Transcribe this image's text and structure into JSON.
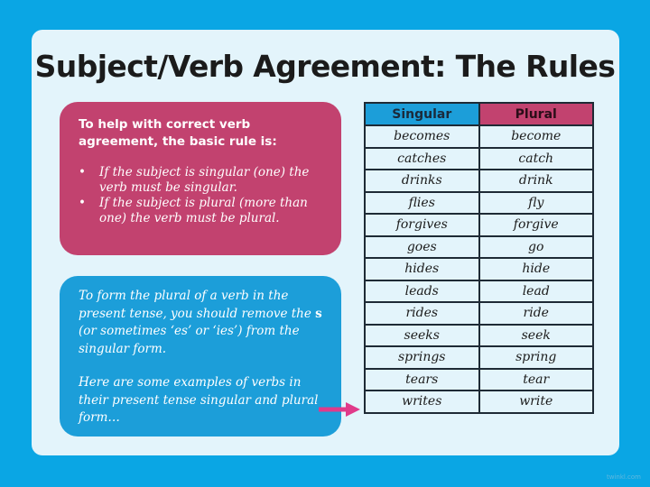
{
  "title": "Subject/Verb Agreement: The Rules",
  "rule_box": {
    "intro": "To help with correct verb agreement, the basic rule is:",
    "bullets": [
      "If the subject is singular (one) the verb must be singular.",
      "If the subject is plural (more than one) the verb must be plural."
    ],
    "bullet_glyph": "•"
  },
  "plural_box": {
    "para1_before": "To form the plural of a verb in the present tense, you should remove the ",
    "para1_bold": "s",
    "para1_after": " (or sometimes ‘es’ or ‘ies’) from the singular form.",
    "para2": "Here are some examples of verbs in their present tense singular and plural form…"
  },
  "arrow": {
    "icon": "arrow-right-icon",
    "color": "#e03a8a"
  },
  "table": {
    "headers": [
      "Singular",
      "Plural"
    ],
    "rows": [
      [
        "becomes",
        "become"
      ],
      [
        "catches",
        "catch"
      ],
      [
        "drinks",
        "drink"
      ],
      [
        "flies",
        "fly"
      ],
      [
        "forgives",
        "forgive"
      ],
      [
        "goes",
        "go"
      ],
      [
        "hides",
        "hide"
      ],
      [
        "leads",
        "lead"
      ],
      [
        "rides",
        "ride"
      ],
      [
        "seeks",
        "seek"
      ],
      [
        "springs",
        "spring"
      ],
      [
        "tears",
        "tear"
      ],
      [
        "writes",
        "write"
      ]
    ]
  },
  "colors": {
    "background": "#0aa6e4",
    "card": "#e3f4fb",
    "pink": "#c2426f",
    "blue": "#1c9ed9"
  },
  "watermark": "twinkl.com"
}
